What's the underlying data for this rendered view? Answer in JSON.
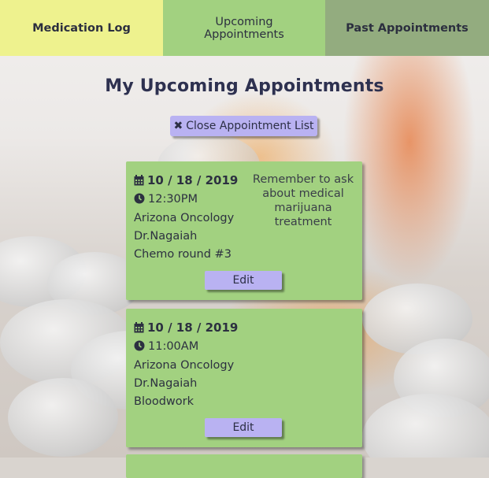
{
  "nav": {
    "medication_log": "Medication Log",
    "upcoming_line1": "Upcoming",
    "upcoming_line2": "Appointments",
    "past_appointments": "Past Appointments"
  },
  "page_title": "My Upcoming Appointments",
  "close_button_label": "Close Appointment List",
  "appointments": [
    {
      "date": "10 / 18 / 2019",
      "time": "12:30PM",
      "location": "Arizona Oncology",
      "doctor": "Dr.Nagaiah",
      "purpose": "Chemo round #3",
      "note_line1": "Remember to ask",
      "note_line2": "about medical",
      "note_line3": "marijuana treatment",
      "edit_label": "Edit"
    },
    {
      "date": "10 / 18 / 2019",
      "time": "11:00AM",
      "location": "Arizona Oncology",
      "doctor": "Dr.Nagaiah",
      "purpose": "Bloodwork",
      "edit_label": "Edit"
    }
  ],
  "icons": {
    "calendar": "calendar-icon",
    "clock": "clock-icon",
    "close": "close-icon"
  },
  "colors": {
    "nav_medication": "#eef28e",
    "nav_upcoming": "#a2d180",
    "nav_past": "#93ac7f",
    "card": "#a2d180",
    "button": "#b9b2f2",
    "text": "#2c2f3f"
  }
}
